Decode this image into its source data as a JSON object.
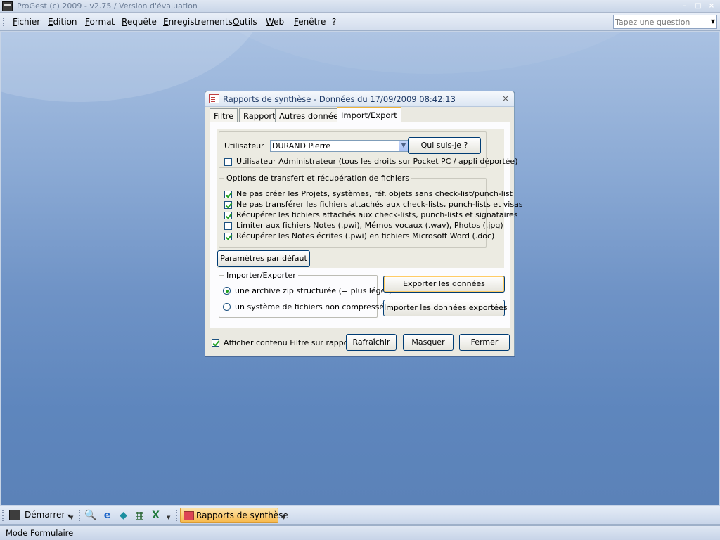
{
  "window": {
    "title": "ProGest (c) 2009 - v2.75 / Version d'évaluation"
  },
  "menu": [
    "Fichier",
    "Edition",
    "Format",
    "Requête",
    "Enregistrements",
    "Outils",
    "Web",
    "Fenêtre",
    "?"
  ],
  "help": {
    "placeholder": "Tapez une question"
  },
  "dialog": {
    "title": "Rapports de synthèse - Données du 17/09/2009 08:42:13",
    "tabs": [
      "Filtre",
      "Rapport",
      "Autres données",
      "Import/Export"
    ],
    "active_tab": "Import/Export",
    "user": {
      "label": "Utilisateur",
      "value": "DURAND Pierre",
      "whoami_label": "Qui suis-je ?",
      "admin_label": "Utilisateur Administrateur (tous les droits sur Pocket PC / appli déportée)",
      "admin_checked": false
    },
    "options": {
      "legend": "Options de transfert et récupération de fichiers",
      "items": [
        {
          "label": "Ne pas créer les Projets, systèmes, réf. objets sans check-list/punch-list",
          "checked": true
        },
        {
          "label": "Ne pas transférer les fichiers attachés aux check-lists, punch-lists et visas",
          "checked": true
        },
        {
          "label": "Récupérer les fichiers attachés aux check-lists, punch-lists et signataires",
          "checked": true
        },
        {
          "label": "Limiter aux fichiers Notes (.pwi), Mémos vocaux (.wav), Photos (.jpg)",
          "checked": false
        },
        {
          "label": "Récupérer les Notes écrites (.pwi) en fichiers Microsoft Word (.doc)",
          "checked": true
        }
      ]
    },
    "defaults_label": "Paramètres par défaut",
    "import_export": {
      "legend": "Importer/Exporter",
      "radios": [
        {
          "label": "une archive zip structurée (= plus léger)",
          "checked": true
        },
        {
          "label": "un système de fichiers non compressés",
          "checked": false
        }
      ],
      "export_label": "Exporter les données",
      "import_label": "Importer les données exportées"
    },
    "footer": {
      "show_filter_label": "Afficher contenu Filtre sur rapports",
      "show_filter_checked": true,
      "refresh_label": "Rafraîchir",
      "hide_label": "Masquer",
      "close_label": "Fermer"
    }
  },
  "taskbar": {
    "start_label": "Démarrer",
    "quick_icons": [
      "search-document-icon",
      "internet-explorer-icon",
      "shortcut-icon",
      "calculator-icon",
      "excel-icon"
    ],
    "task_label": "Rapports de synthèse"
  },
  "status": {
    "text": "Mode Formulaire"
  },
  "colors": {
    "accent_tab": "#f0b43a",
    "workspace_blue": "#5e86bd",
    "task_button": "#f7b84b"
  }
}
